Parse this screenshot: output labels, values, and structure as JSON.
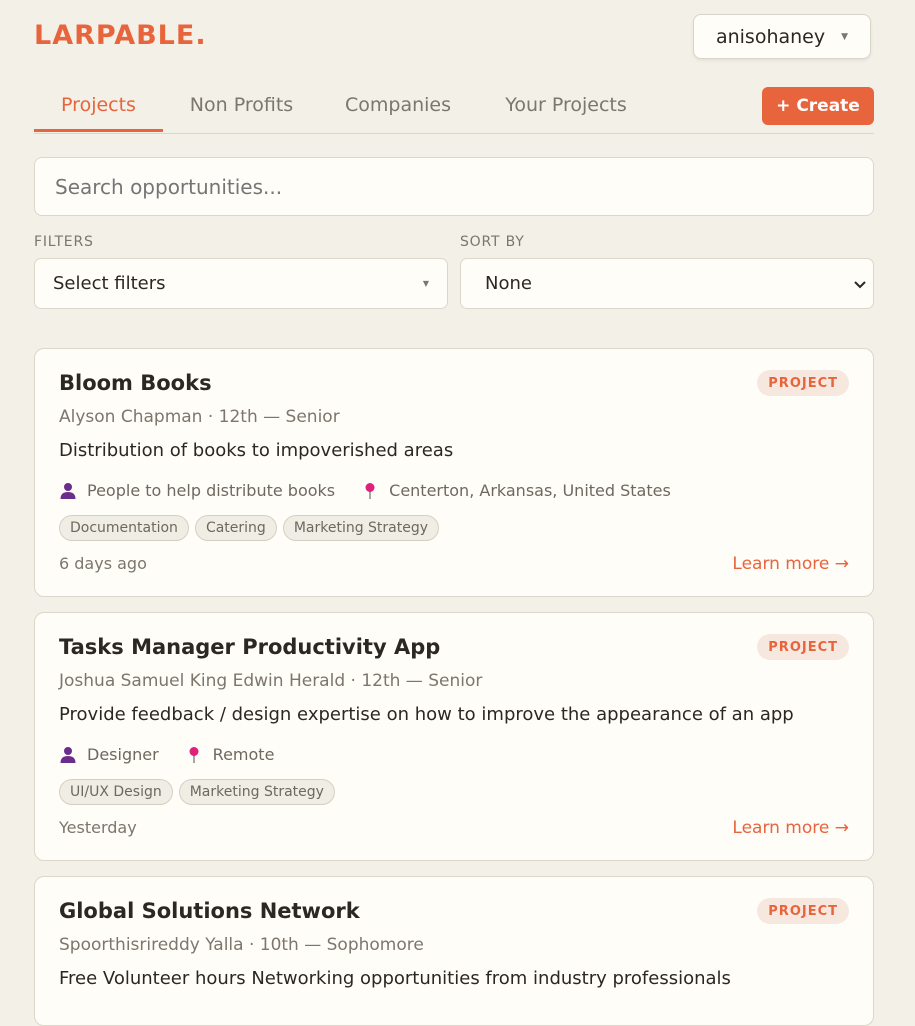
{
  "app": {
    "logo": "LARPABLE.",
    "brand_color": "#e8643c"
  },
  "user": {
    "name": "anisohaney"
  },
  "tabs": [
    {
      "label": "Projects",
      "active": true
    },
    {
      "label": "Non Profits",
      "active": false
    },
    {
      "label": "Companies",
      "active": false
    },
    {
      "label": "Your Projects",
      "active": false
    }
  ],
  "create_label": "+ Create",
  "search": {
    "placeholder": "Search opportunities..."
  },
  "filters": {
    "label": "FILTERS",
    "value": "Select filters"
  },
  "sort": {
    "label": "SORT BY",
    "value": "None",
    "options": [
      "None"
    ]
  },
  "cards": [
    {
      "title": "Bloom Books",
      "badge": "PROJECT",
      "subtitle": "Alyson Chapman · 12th — Senior",
      "description": "Distribution of books to impoverished areas",
      "role_icon": "person-icon",
      "role": "People to help distribute books",
      "location_icon": "pin-icon",
      "location": "Centerton, Arkansas, United States",
      "tags": [
        "Documentation",
        "Catering",
        "Marketing Strategy"
      ],
      "time": "6 days ago",
      "link": "Learn more →"
    },
    {
      "title": "Tasks Manager Productivity App",
      "badge": "PROJECT",
      "subtitle": "Joshua Samuel King Edwin Herald · 12th — Senior",
      "description": "Provide feedback / design expertise on how to improve the appearance of an app",
      "role_icon": "person-icon",
      "role": "Designer",
      "location_icon": "pin-icon",
      "location": "Remote",
      "tags": [
        "UI/UX Design",
        "Marketing Strategy"
      ],
      "time": "Yesterday",
      "link": "Learn more →"
    },
    {
      "title": "Global Solutions Network",
      "badge": "PROJECT",
      "subtitle": "Spoorthisrireddy Yalla · 10th — Sophomore",
      "description": "Free Volunteer hours Networking opportunities from industry professionals"
    }
  ]
}
